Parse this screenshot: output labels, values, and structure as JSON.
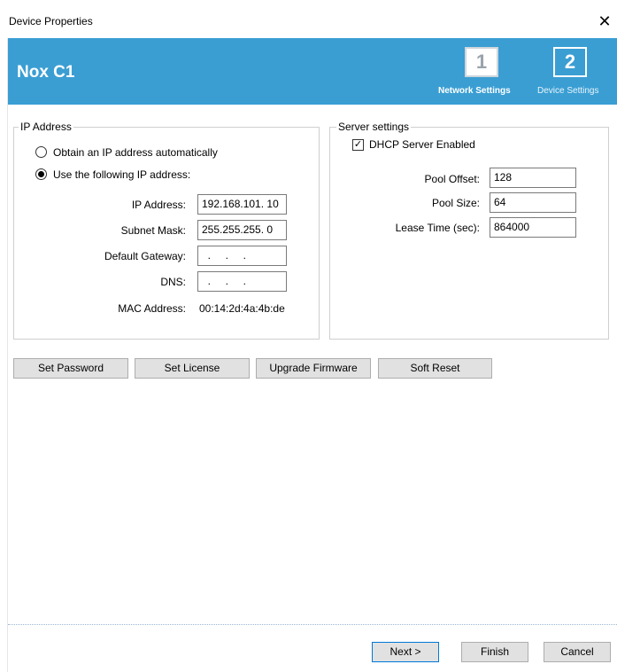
{
  "window": {
    "title": "Device Properties",
    "close_glyph": "✕"
  },
  "banner": {
    "device_name": "Nox C1",
    "steps": [
      {
        "number": "1",
        "label": "Network Settings",
        "active": true
      },
      {
        "number": "2",
        "label": "Device Settings",
        "active": false
      }
    ],
    "color": "#3a9ed3"
  },
  "ip_address": {
    "legend": "IP Address",
    "option_auto": "Obtain an IP address automatically",
    "option_manual": "Use the following IP address:",
    "selected": "manual",
    "fields": {
      "ip_label": "IP Address:",
      "ip_value": "192.168.101. 10",
      "subnet_label": "Subnet Mask:",
      "subnet_value": "255.255.255.  0",
      "gateway_label": "Default Gateway:",
      "gateway_value": "  .     .     .  ",
      "dns_label": "DNS:",
      "dns_value": "  .     .     .  ",
      "mac_label": "MAC Address:",
      "mac_value": "00:14:2d:4a:4b:de"
    }
  },
  "server_settings": {
    "legend": "Server settings",
    "dhcp_label": "DHCP Server Enabled",
    "dhcp_checked": true,
    "pool_offset_label": "Pool Offset:",
    "pool_offset_value": "128",
    "pool_size_label": "Pool Size:",
    "pool_size_value": "64",
    "lease_time_label": "Lease Time (sec):",
    "lease_time_value": "864000"
  },
  "actions": {
    "set_password": "Set Password",
    "set_license": "Set License",
    "upgrade_firmware": "Upgrade Firmware",
    "soft_reset": "Soft Reset"
  },
  "footer": {
    "next": "Next >",
    "finish": "Finish",
    "cancel": "Cancel"
  }
}
